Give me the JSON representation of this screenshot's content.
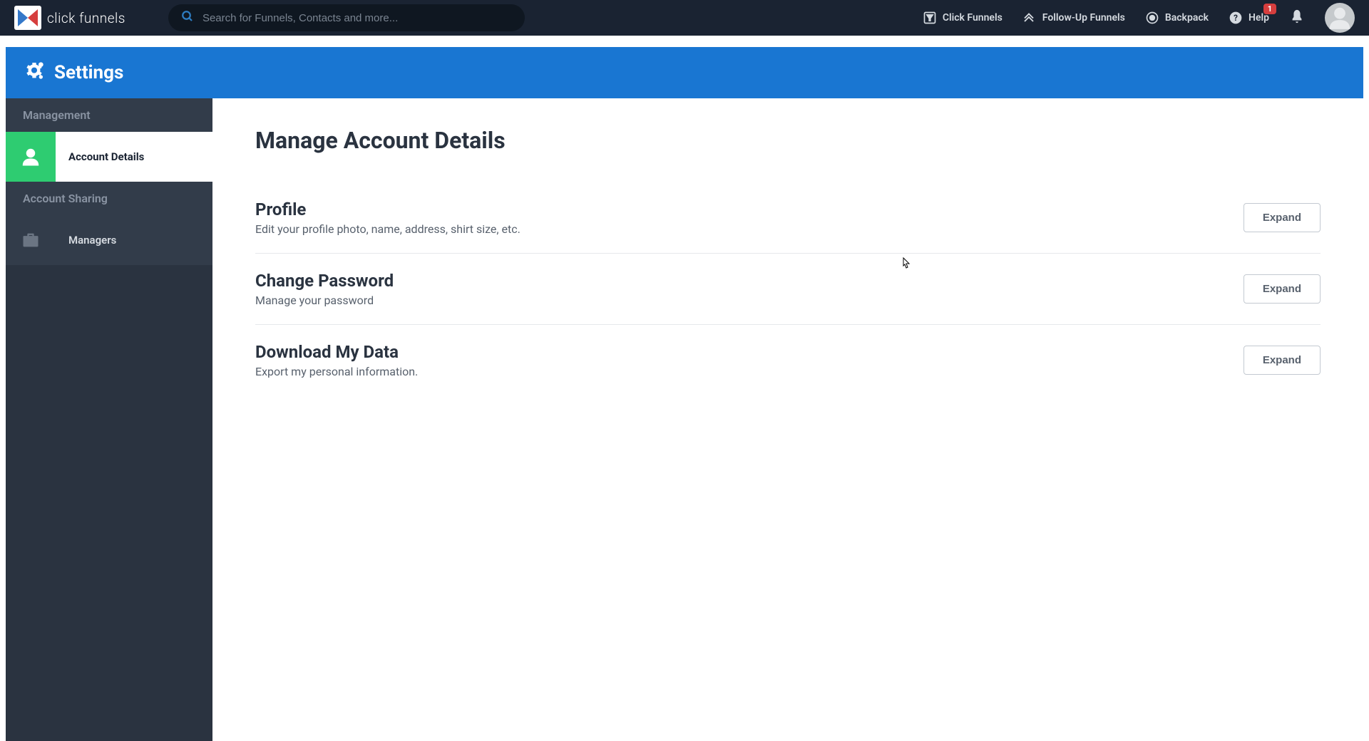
{
  "logo_text": "click funnels",
  "search_placeholder": "Search for Funnels, Contacts and more...",
  "topnav": {
    "click_funnels": "Click Funnels",
    "follow_up": "Follow-Up Funnels",
    "backpack": "Backpack",
    "help": "Help",
    "help_badge": "1"
  },
  "settings_header": "Settings",
  "sidebar": {
    "section_management": "Management",
    "item_account_details": "Account Details",
    "section_account_sharing": "Account Sharing",
    "item_managers": "Managers"
  },
  "page": {
    "title": "Manage Account Details",
    "sections": [
      {
        "title": "Profile",
        "desc": "Edit your profile photo, name, address, shirt size, etc.",
        "button": "Expand"
      },
      {
        "title": "Change Password",
        "desc": "Manage your password",
        "button": "Expand"
      },
      {
        "title": "Download My Data",
        "desc": "Export my personal information.",
        "button": "Expand"
      }
    ]
  }
}
